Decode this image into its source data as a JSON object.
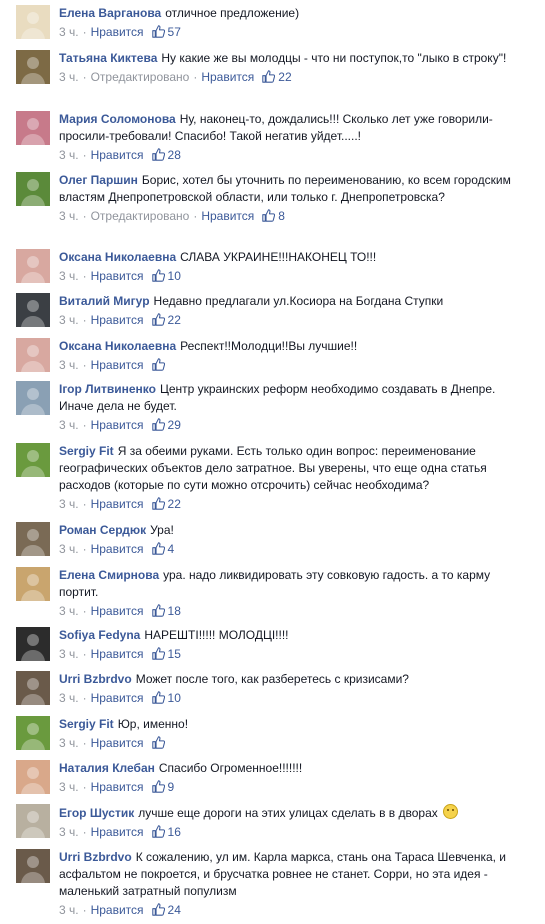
{
  "colors": {
    "link": "#3b5998",
    "meta": "#90949c",
    "text": "#141823"
  },
  "labels": {
    "time": "3 ч.",
    "edited": "Отредактировано",
    "like": "Нравится"
  },
  "comments": [
    {
      "author": "Елена Варганова",
      "text": "отличное предложение)",
      "edited": false,
      "likes": "57",
      "avatar_color": "#e9dcc0"
    },
    {
      "author": "Татьяна Киктева",
      "text": "Ну какие же вы молодцы - что ни поступок,то \"лыко в строку\"!",
      "edited": true,
      "likes": "22",
      "avatar_color": "#7d6a45"
    },
    {
      "author": "Мария Соломонова",
      "text": "Ну, наконец-то, дождались!!! Сколько лет уже говорили-просили-требовали! Спасибо! Такой негатив уйдет.....!",
      "edited": false,
      "likes": "28",
      "avatar_color": "#c77a8a"
    },
    {
      "author": "Олег Паршин",
      "text": "Борис, хотел бы уточнить по переименованию, ко всем городским властям Днепропетровской области, или только г. Днепропетровска?",
      "edited": true,
      "likes": "8",
      "avatar_color": "#5b8a3a"
    },
    {
      "author": "Оксана Николаевна",
      "text": "СЛАВА УКРАИНЕ!!!НАКОНЕЦ ТО!!!",
      "edited": false,
      "likes": "10",
      "avatar_color": "#d8a8a0"
    },
    {
      "author": "Виталий Мигур",
      "text": "Недавно предлагали ул.Косиора на Богдана Ступки",
      "edited": false,
      "likes": "22",
      "avatar_color": "#3b3f44"
    },
    {
      "author": "Оксана Николаевна",
      "text": "Респект!!Молодци!!Вы лучшие!!",
      "edited": false,
      "likes": "",
      "avatar_color": "#d8a8a0"
    },
    {
      "author": "Ігор Литвиненко",
      "text": "Центр украинских реформ необходимо создавать в Днепре. Иначе дела не будет.",
      "edited": false,
      "likes": "29",
      "avatar_color": "#8aa0b4"
    },
    {
      "author": "Sergiy Fit",
      "text": "Я за обеими руками. Есть только один вопрос: переименование географических объектов дело затратное. Вы уверены, что еще одна статья расходов (которые по сути можно отсрочить) сейчас необходима?",
      "edited": false,
      "likes": "22",
      "avatar_color": "#6a9a3e"
    },
    {
      "author": "Роман Сердюк",
      "text": "Ура!",
      "edited": false,
      "likes": "4",
      "avatar_color": "#7a6a55"
    },
    {
      "author": "Елена Смирнова",
      "text": "ура. надо ликвидировать эту совковую гадость. а то карму портит.",
      "edited": false,
      "likes": "18",
      "avatar_color": "#c9a56e"
    },
    {
      "author": "Sofiya Fedyna",
      "text": "НАРЕШТІ!!!!! МОЛОДЦІ!!!!",
      "edited": false,
      "likes": "15",
      "avatar_color": "#2c2c2c"
    },
    {
      "author": "Urri Bzbrdvo",
      "text": "Может после того, как разберетесь с кризисами?",
      "edited": false,
      "likes": "10",
      "avatar_color": "#6a5a4a"
    },
    {
      "author": "Sergiy Fit",
      "text": "Юр, именно!",
      "edited": false,
      "likes": "",
      "avatar_color": "#6a9a3e"
    },
    {
      "author": "Наталия Клебан",
      "text": "Спасибо Огроменное!!!!!!!",
      "edited": false,
      "likes": "9",
      "avatar_color": "#d9a88a"
    },
    {
      "author": "Егор Шустик",
      "text": "лучше еще дороги на этих улицах сделать в в дворах",
      "edited": false,
      "likes": "16",
      "avatar_color": "#b8b0a0",
      "emoji": "smiley"
    },
    {
      "author": "Urri Bzbrdvo",
      "text": "К сожалению, ул им. Карла маркса, стань она Тараса Шевченка, и асфальтом не покроется, и брусчатка ровнее не станет. Сорри, но эта идея - маленький затратный популизм",
      "edited": false,
      "likes": "24",
      "avatar_color": "#6a5a4a"
    }
  ]
}
